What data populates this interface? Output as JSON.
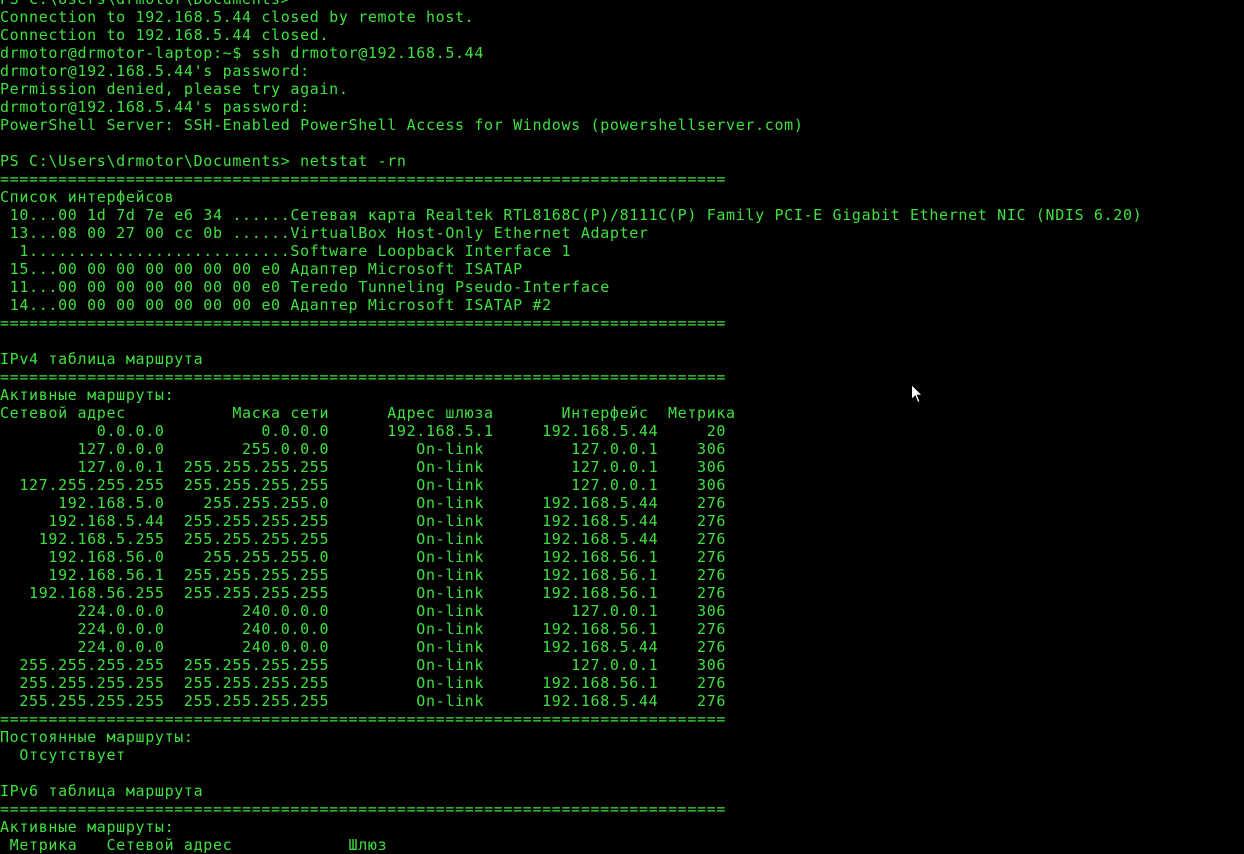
{
  "terminal": {
    "text_color": "#3fe03f",
    "background_color": "#000000",
    "lines": [
      "PS C:\\Users\\drmotor\\Documents>",
      "Connection to 192.168.5.44 closed by remote host.",
      "Connection to 192.168.5.44 closed.",
      "drmotor@drmotor-laptop:~$ ssh drmotor@192.168.5.44",
      "drmotor@192.168.5.44's password:",
      "Permission denied, please try again.",
      "drmotor@192.168.5.44's password:",
      "PowerShell Server: SSH-Enabled PowerShell Access for Windows (powershellserver.com)",
      "",
      "PS C:\\Users\\drmotor\\Documents> netstat -rn",
      "===========================================================================",
      "Список интерфейсов",
      " 10...00 1d 7d 7e e6 34 ......Сетевая карта Realtek RTL8168C(P)/8111C(P) Family PCI-E Gigabit Ethernet NIC (NDIS 6.20)",
      " 13...08 00 27 00 cc 0b ......VirtualBox Host-Only Ethernet Adapter",
      "  1...........................Software Loopback Interface 1",
      " 15...00 00 00 00 00 00 00 e0 Адаптер Microsoft ISATAP",
      " 11...00 00 00 00 00 00 00 e0 Teredo Tunneling Pseudo-Interface",
      " 14...00 00 00 00 00 00 00 e0 Адаптер Microsoft ISATAP #2",
      "===========================================================================",
      "",
      "IPv4 таблица маршрута",
      "===========================================================================",
      "Активные маршруты:",
      "Сетевой адрес           Маска сети      Адрес шлюза       Интерфейс  Метрика",
      "          0.0.0.0          0.0.0.0      192.168.5.1     192.168.5.44     20",
      "        127.0.0.0        255.0.0.0         On-link         127.0.0.1    306",
      "        127.0.0.1  255.255.255.255         On-link         127.0.0.1    306",
      "  127.255.255.255  255.255.255.255         On-link         127.0.0.1    306",
      "      192.168.5.0    255.255.255.0         On-link      192.168.5.44    276",
      "     192.168.5.44  255.255.255.255         On-link      192.168.5.44    276",
      "    192.168.5.255  255.255.255.255         On-link      192.168.5.44    276",
      "     192.168.56.0    255.255.255.0         On-link      192.168.56.1    276",
      "     192.168.56.1  255.255.255.255         On-link      192.168.56.1    276",
      "   192.168.56.255  255.255.255.255         On-link      192.168.56.1    276",
      "        224.0.0.0        240.0.0.0         On-link         127.0.0.1    306",
      "        224.0.0.0        240.0.0.0         On-link      192.168.56.1    276",
      "        224.0.0.0        240.0.0.0         On-link      192.168.5.44    276",
      "  255.255.255.255  255.255.255.255         On-link         127.0.0.1    306",
      "  255.255.255.255  255.255.255.255         On-link      192.168.56.1    276",
      "  255.255.255.255  255.255.255.255         On-link      192.168.5.44    276",
      "===========================================================================",
      "Постоянные маршруты:",
      "  Отсутствует",
      "",
      "IPv6 таблица маршрута",
      "===========================================================================",
      "Активные маршруты:",
      " Метрика   Сетевой адрес            Шлюз"
    ]
  },
  "cursor": {
    "icon": "mouse-pointer-icon"
  }
}
